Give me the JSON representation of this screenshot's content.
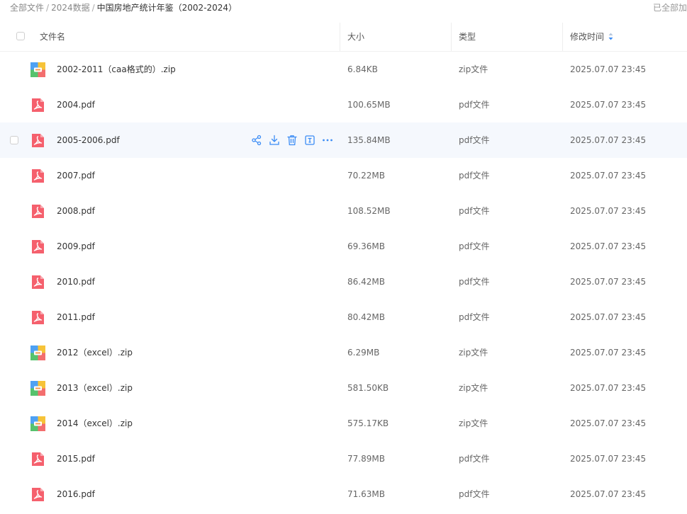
{
  "breadcrumb": {
    "items": [
      "全部文件",
      "2024数据"
    ],
    "separator": "/",
    "current": "中国房地产统计年鉴（2002-2024）"
  },
  "top_right_text": "已全部加",
  "columns": {
    "name": "文件名",
    "size": "大小",
    "type": "类型",
    "modified": "修改时间"
  },
  "hover_row_index": 2,
  "row_action_icons": [
    "share-icon",
    "download-icon",
    "trash-icon",
    "rename-icon",
    "more-icon"
  ],
  "colors": {
    "accent": "#3b8cf5",
    "pdf_red": "#f5606d",
    "hover_bg": "#f5f8fd"
  },
  "files": [
    {
      "name": "2002-2011（caa格式的）.zip",
      "icon": "zip",
      "size": "6.84KB",
      "type": "zip文件",
      "modified": "2025.07.07 23:45"
    },
    {
      "name": "2004.pdf",
      "icon": "pdf",
      "size": "100.65MB",
      "type": "pdf文件",
      "modified": "2025.07.07 23:45"
    },
    {
      "name": "2005-2006.pdf",
      "icon": "pdf",
      "size": "135.84MB",
      "type": "pdf文件",
      "modified": "2025.07.07 23:45"
    },
    {
      "name": "2007.pdf",
      "icon": "pdf",
      "size": "70.22MB",
      "type": "pdf文件",
      "modified": "2025.07.07 23:45"
    },
    {
      "name": "2008.pdf",
      "icon": "pdf",
      "size": "108.52MB",
      "type": "pdf文件",
      "modified": "2025.07.07 23:45"
    },
    {
      "name": "2009.pdf",
      "icon": "pdf",
      "size": "69.36MB",
      "type": "pdf文件",
      "modified": "2025.07.07 23:45"
    },
    {
      "name": "2010.pdf",
      "icon": "pdf",
      "size": "86.42MB",
      "type": "pdf文件",
      "modified": "2025.07.07 23:45"
    },
    {
      "name": "2011.pdf",
      "icon": "pdf",
      "size": "80.42MB",
      "type": "pdf文件",
      "modified": "2025.07.07 23:45"
    },
    {
      "name": "2012（excel）.zip",
      "icon": "zip",
      "size": "6.29MB",
      "type": "zip文件",
      "modified": "2025.07.07 23:45"
    },
    {
      "name": "2013（excel）.zip",
      "icon": "zip",
      "size": "581.50KB",
      "type": "zip文件",
      "modified": "2025.07.07 23:45"
    },
    {
      "name": "2014（excel）.zip",
      "icon": "zip",
      "size": "575.17KB",
      "type": "zip文件",
      "modified": "2025.07.07 23:45"
    },
    {
      "name": "2015.pdf",
      "icon": "pdf",
      "size": "77.89MB",
      "type": "pdf文件",
      "modified": "2025.07.07 23:45"
    },
    {
      "name": "2016.pdf",
      "icon": "pdf",
      "size": "71.63MB",
      "type": "pdf文件",
      "modified": "2025.07.07 23:45"
    }
  ]
}
